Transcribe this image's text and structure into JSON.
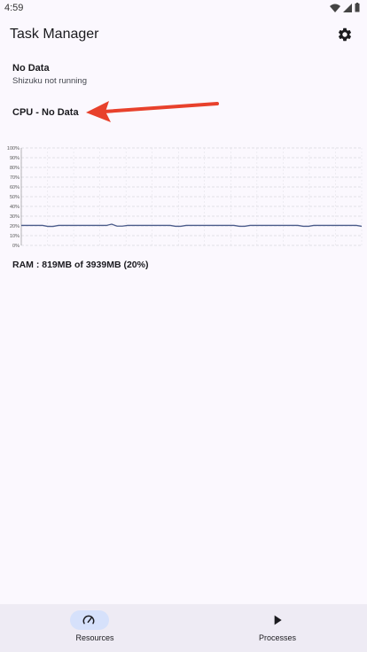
{
  "status_bar": {
    "time": "4:59"
  },
  "app": {
    "title": "Task Manager"
  },
  "device": {
    "title": "No Data",
    "subtitle": "Shizuku not running"
  },
  "cpu": {
    "label": "CPU - No Data"
  },
  "ram": {
    "label": "RAM : 819MB of 3939MB (20%)"
  },
  "chart_data": {
    "type": "line",
    "ylim": [
      0,
      100
    ],
    "y_ticks": [
      "100%",
      "90%",
      "80%",
      "70%",
      "60%",
      "50%",
      "40%",
      "30%",
      "20%",
      "10%",
      "0%"
    ],
    "grid": true,
    "series": [
      {
        "color": "#4a5b8a",
        "values": [
          20.5,
          20.5,
          20.5,
          20.5,
          20.5,
          19.5,
          19.5,
          20.5,
          20.5,
          20.5,
          20.5,
          20.5,
          20.5,
          20.5,
          20.5,
          20.5,
          20.5,
          21.8,
          19.8,
          19.8,
          20.5,
          20.5,
          20.5,
          20.5,
          20.5,
          20.5,
          20.5,
          20.5,
          20.5,
          19.6,
          19.6,
          20.5,
          20.5,
          20.5,
          20.5,
          20.5,
          20.5,
          20.5,
          20.5,
          20.5,
          20.5,
          19.6,
          19.6,
          20.5,
          20.5,
          20.5,
          20.5,
          20.5,
          20.5,
          20.5,
          20.5,
          20.5,
          20.5,
          19.6,
          19.6,
          20.5,
          20.5,
          20.5,
          20.5,
          20.5,
          20.5,
          20.5,
          20.5,
          20.5,
          19.6
        ]
      }
    ]
  },
  "annotation": {
    "arrow_color": "#e8412c"
  },
  "bottom_nav": {
    "items": [
      {
        "label": "Resources",
        "icon": "speedometer-icon",
        "active": true
      },
      {
        "label": "Processes",
        "icon": "play-icon",
        "active": false
      }
    ]
  }
}
